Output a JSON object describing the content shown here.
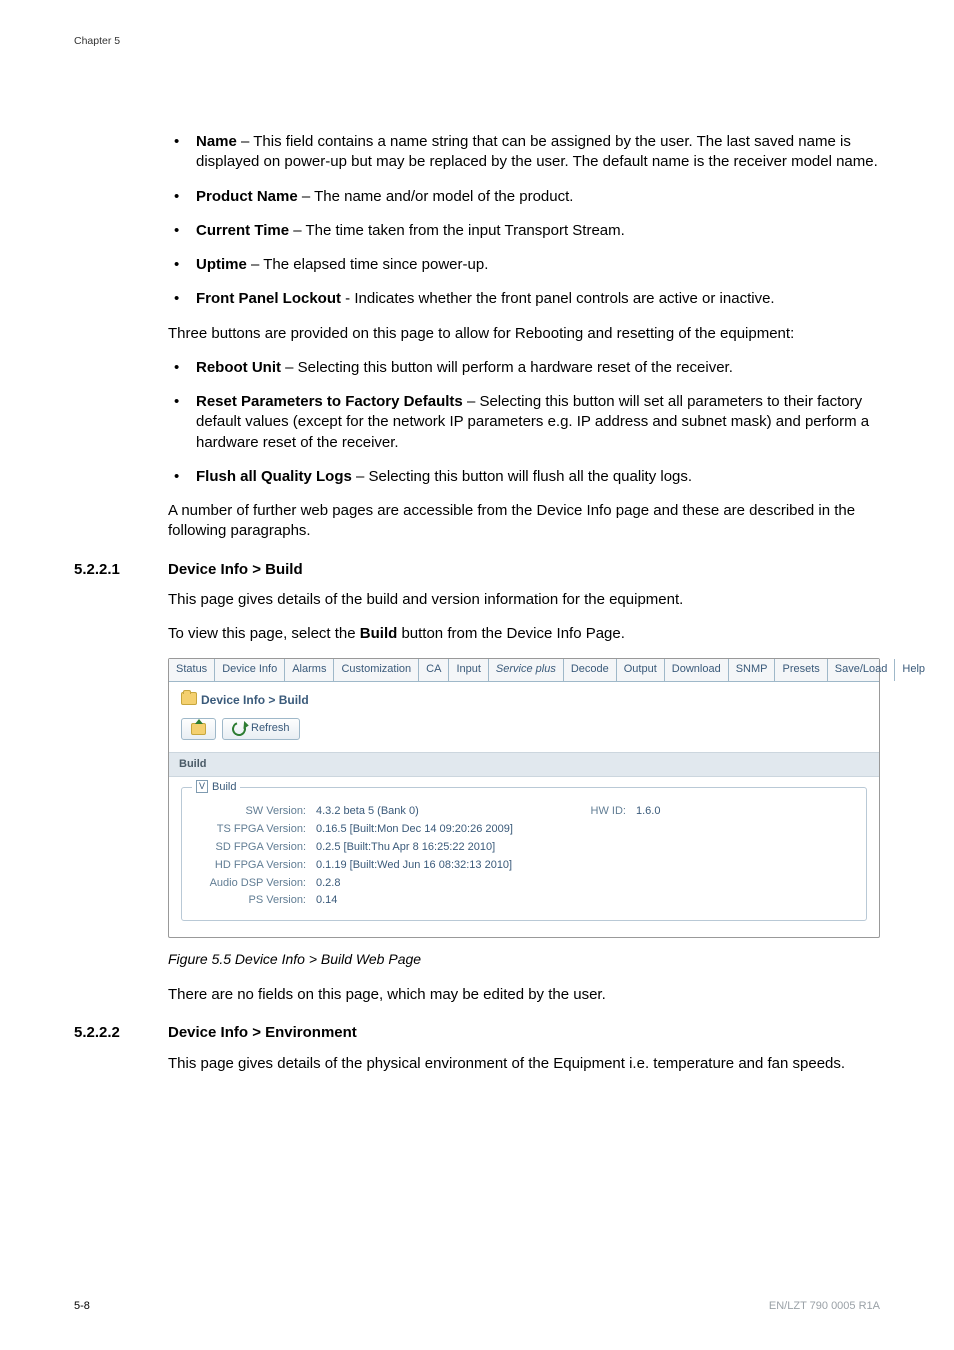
{
  "header": {
    "chapter": "Chapter 5"
  },
  "bullets_top": [
    {
      "term": "Name",
      "rest": " – This field contains a name string that can be assigned by the user. The last saved name is displayed on power-up but may be replaced by the user. The default name is the receiver model name."
    },
    {
      "term": "Product Name",
      "rest": " – The name and/or model of the product."
    },
    {
      "term": "Current Time",
      "rest": " – The time taken from the input Transport Stream."
    },
    {
      "term": "Uptime",
      "rest": " – The elapsed time since power-up."
    },
    {
      "term": "Front Panel Lockout",
      "rest": " - Indicates whether the front panel controls are active or inactive."
    }
  ],
  "para1": "Three buttons are provided on this page to allow for Rebooting and resetting of the equipment:",
  "bullets_mid": [
    {
      "term": "Reboot Unit",
      "rest": " – Selecting this button will perform a hardware reset of the receiver."
    },
    {
      "term": "Reset Parameters to Factory Defaults",
      "rest": " – Selecting this button will set all parameters to their factory default values (except for the network IP parameters e.g. IP address and subnet mask) and perform a hardware reset of the receiver."
    },
    {
      "term": "Flush all Quality Logs",
      "rest": " – Selecting this button will flush all the quality logs."
    }
  ],
  "para2": "A number of further web pages are accessible from the Device Info page and these are described in the following paragraphs.",
  "h1": {
    "num": "5.2.2.1",
    "title": "Device Info > Build"
  },
  "h1_p1": "This page gives details of the build and version information for the equipment.",
  "h1_p2a": "To view this page, select the ",
  "h1_p2b": "Build",
  "h1_p2c": " button from the Device Info Page.",
  "shot": {
    "tabs": [
      "Status",
      "Device Info",
      "Alarms",
      "Customization",
      "CA",
      "Input",
      "Service plus",
      "Decode",
      "Output",
      "Download",
      "SNMP",
      "Presets",
      "Save/Load",
      "Help"
    ],
    "breadcrumb": "Device Info > Build",
    "refresh": "Refresh",
    "section": "Build",
    "legend": "Build",
    "rows": [
      {
        "k": "SW Version:",
        "v": "4.3.2 beta 5 (Bank 0)",
        "k2": "HW ID:",
        "v2": "1.6.0"
      },
      {
        "k": "TS FPGA Version:",
        "v": "0.16.5 [Built:Mon Dec 14 09:20:26 2009]"
      },
      {
        "k": "SD FPGA Version:",
        "v": "0.2.5 [Built:Thu Apr 8 16:25:22 2010]"
      },
      {
        "k": "HD FPGA Version:",
        "v": "0.1.19 [Built:Wed Jun 16 08:32:13 2010]"
      },
      {
        "k": "Audio DSP Version:",
        "v": "0.2.8"
      },
      {
        "k": "PS Version:",
        "v": "0.14"
      }
    ]
  },
  "figcap": "Figure 5.5   Device Info > Build Web Page",
  "h1_p3": "There are no fields on this page, which may be edited by the user.",
  "h2": {
    "num": "5.2.2.2",
    "title": "Device Info > Environment"
  },
  "h2_p1": "This page gives details of the physical environment of the Equipment i.e. temperature and fan speeds.",
  "footer": {
    "page": "5-8",
    "doc": "EN/LZT 790 0005 R1A"
  }
}
